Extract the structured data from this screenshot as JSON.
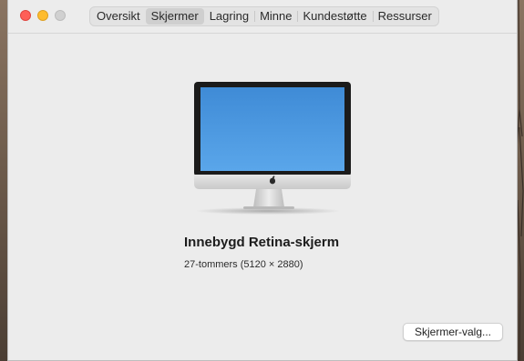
{
  "window": {
    "tabs": [
      {
        "label": "Oversikt",
        "active": false
      },
      {
        "label": "Skjermer",
        "active": true
      },
      {
        "label": "Lagring",
        "active": false
      },
      {
        "label": "Minne",
        "active": false
      },
      {
        "label": "Kundestøtte",
        "active": false
      },
      {
        "label": "Ressurser",
        "active": false
      }
    ],
    "traffic_lights": {
      "close": "#fe5f57",
      "minimize": "#febc2e",
      "zoom": "#d0d0d0"
    }
  },
  "display": {
    "icon": "imac-icon",
    "name": "Innebygd Retina-skjerm",
    "spec": "27-tommers (5120 × 2880)",
    "screen_color": "#4f9be0"
  },
  "actions": {
    "display_prefs_label": "Skjermer-valg..."
  }
}
